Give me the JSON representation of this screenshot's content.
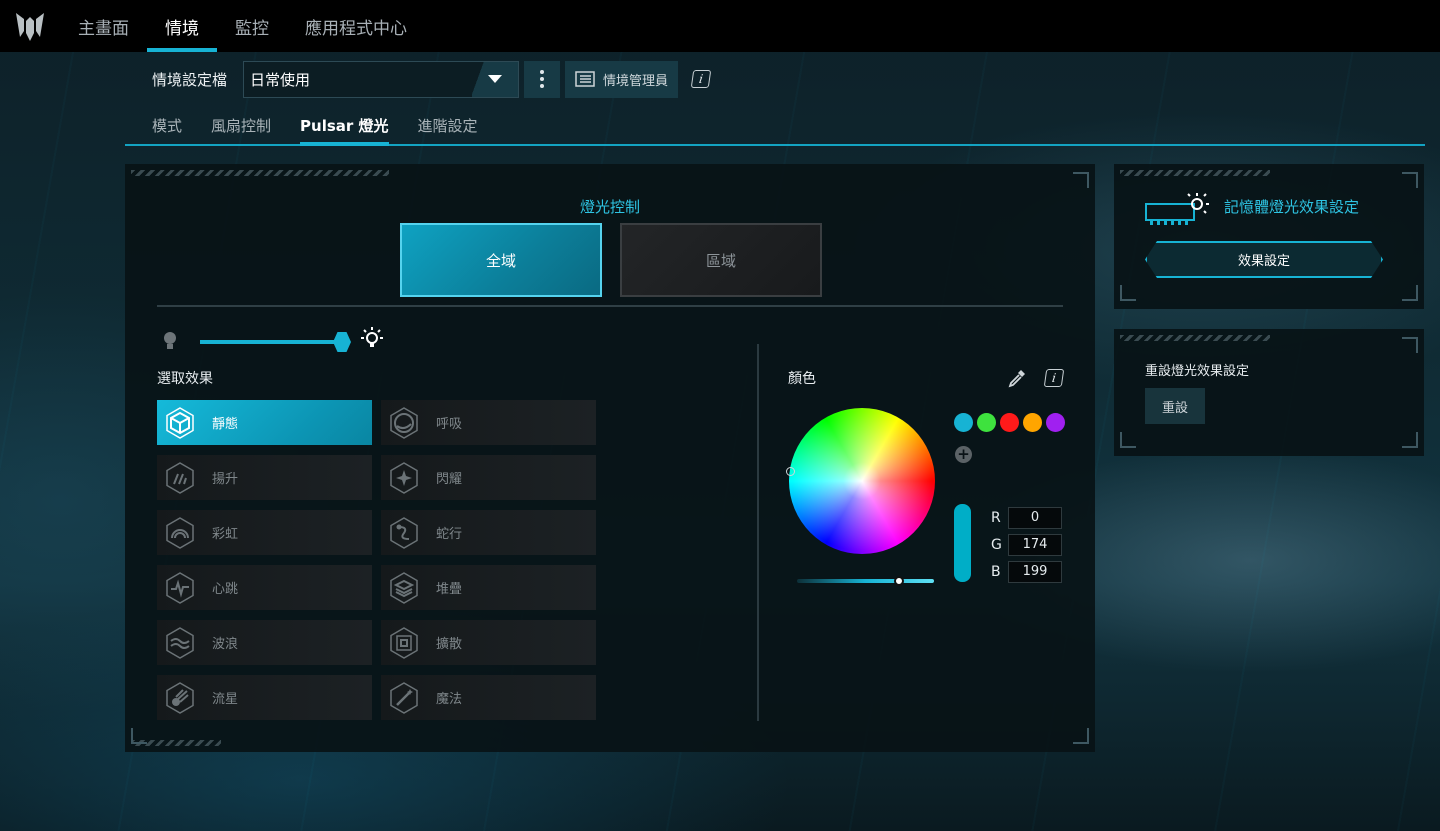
{
  "nav": {
    "tabs": [
      "主畫面",
      "情境",
      "監控",
      "應用程式中心"
    ],
    "active_index": 1
  },
  "profile": {
    "label": "情境設定檔",
    "selected": "日常使用",
    "manager_label": "情境管理員"
  },
  "subtabs": {
    "items": [
      "模式",
      "風扇控制",
      "Pulsar 燈光",
      "進階設定"
    ],
    "active_index": 2
  },
  "lighting": {
    "title": "燈光控制",
    "modes": [
      "全域",
      "區域"
    ],
    "active_mode": "全域",
    "brightness_percent": 100,
    "effects_title": "選取效果",
    "effects": [
      {
        "label": "靜態",
        "icon": "cube-icon",
        "active": true
      },
      {
        "label": "呼吸",
        "icon": "breath-icon"
      },
      {
        "label": "揚升",
        "icon": "rise-icon"
      },
      {
        "label": "閃耀",
        "icon": "sparkle-icon"
      },
      {
        "label": "彩虹",
        "icon": "rainbow-icon"
      },
      {
        "label": "蛇行",
        "icon": "snake-icon"
      },
      {
        "label": "心跳",
        "icon": "heartbeat-icon"
      },
      {
        "label": "堆疊",
        "icon": "stack-icon"
      },
      {
        "label": "波浪",
        "icon": "wave-icon"
      },
      {
        "label": "擴散",
        "icon": "ripple-icon"
      },
      {
        "label": "流星",
        "icon": "meteor-icon"
      },
      {
        "label": "魔法",
        "icon": "magic-wand-icon"
      }
    ]
  },
  "color": {
    "title": "顏色",
    "swatches": [
      "#17b3d4",
      "#3ee23e",
      "#ff1a1a",
      "#ffa500",
      "#a020f0"
    ],
    "preview": "#00aec7",
    "rgb": {
      "r_label": "R",
      "g_label": "G",
      "b_label": "B",
      "r": "0",
      "g": "174",
      "b": "199"
    }
  },
  "memory": {
    "title": "記憶體燈光效果設定",
    "button": "效果設定"
  },
  "reset": {
    "title": "重設燈光效果設定",
    "button": "重設"
  },
  "colors": {
    "accent": "#17b3d4"
  }
}
